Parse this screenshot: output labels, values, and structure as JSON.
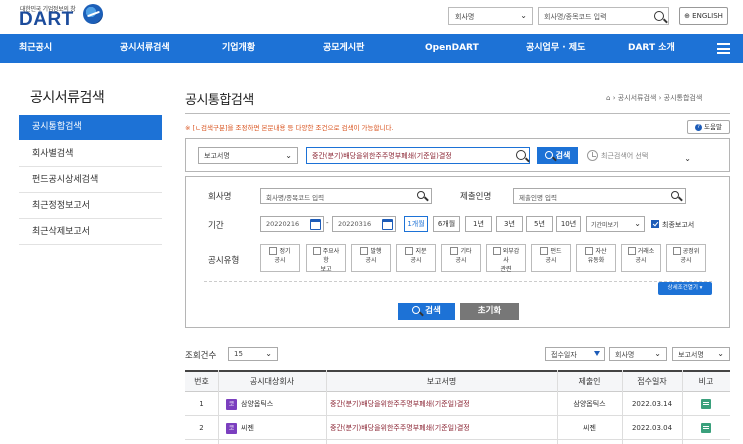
{
  "header": {
    "logo_tagline": "대한민국 기업정보의 창",
    "logo_text": "DART",
    "company_select": "회사명",
    "company_search_placeholder": "회사명/종목코드 입력",
    "english_button": "ENGLISH"
  },
  "nav": {
    "items": [
      "최근공시",
      "공시서류검색",
      "기업개황",
      "공모게시판",
      "OpenDART",
      "공시업무 · 제도",
      "DART 소개"
    ]
  },
  "sidebar": {
    "title": "공시서류검색",
    "items": [
      "공시통합검색",
      "회사별검색",
      "펀드공시상세검색",
      "최근정정보고서",
      "최근삭제보고서"
    ]
  },
  "page": {
    "title": "공시통합검색",
    "breadcrumb": [
      "공시서류검색",
      "공시통합검색"
    ],
    "notice": "※ [ㄴ검색구분]을 조정하면 본문내용 등 다양한 조건으로 검색이 가능합니다.",
    "help_label": "도움말"
  },
  "quick_search": {
    "type_select": "보고서명",
    "query": "중간(분기)배당을위한주주명부폐쇄(기준일)결정",
    "search_button": "검색",
    "recent_placeholder": "최근검색어 선택"
  },
  "form": {
    "company_label": "회사명",
    "company_placeholder": "회사명/종목코드 입력",
    "submitter_label": "제출인명",
    "submitter_placeholder": "제출인명 입력",
    "period_label": "기간",
    "date_from": "20220216",
    "date_sep": "-",
    "date_to": "20220316",
    "period_buttons": [
      "1개월",
      "6개월",
      "1년",
      "3년",
      "5년",
      "10년"
    ],
    "period_select": "기간미보기",
    "final_report_label": "최종보고서",
    "final_report_checked": true,
    "disclosure_type_label": "공시유형",
    "types": [
      {
        "l1": "정기",
        "l2": "공시",
        "l3": ""
      },
      {
        "l1": "주요사",
        "l2": "항",
        "l3": "보고"
      },
      {
        "l1": "발행",
        "l2": "공시",
        "l3": ""
      },
      {
        "l1": "지분",
        "l2": "공시",
        "l3": ""
      },
      {
        "l1": "기타",
        "l2": "공시",
        "l3": ""
      },
      {
        "l1": "외부감",
        "l2": "사",
        "l3": "관련"
      },
      {
        "l1": "펀드",
        "l2": "공시",
        "l3": ""
      },
      {
        "l1": "자산",
        "l2": "유동화",
        "l3": ""
      },
      {
        "l1": "거래소",
        "l2": "공시",
        "l3": ""
      },
      {
        "l1": "공정위",
        "l2": "공시",
        "l3": ""
      }
    ],
    "detail_toggle": "상세조건열기",
    "search_button": "검색",
    "reset_button": "초기화"
  },
  "results": {
    "count_label": "조회건수",
    "count_value": "15",
    "sort_select": "접수일자",
    "sort_company": "회사명",
    "sort_report": "보고서명",
    "columns": [
      "번호",
      "공시대상회사",
      "보고서명",
      "제출인",
      "접수일자",
      "비고"
    ],
    "rows": [
      {
        "no": "1",
        "badge": "코",
        "company": "삼양옵틱스",
        "report": "중간(분기)배당을위한주주명부폐쇄(기준일)결정",
        "submitter": "삼양옵틱스",
        "date": "2022.03.14"
      },
      {
        "no": "2",
        "badge": "코",
        "company": "씨젠",
        "report": "중간(분기)배당을위한주주명부폐쇄(기준일)결정",
        "submitter": "씨젠",
        "date": "2022.03.04"
      }
    ]
  }
}
